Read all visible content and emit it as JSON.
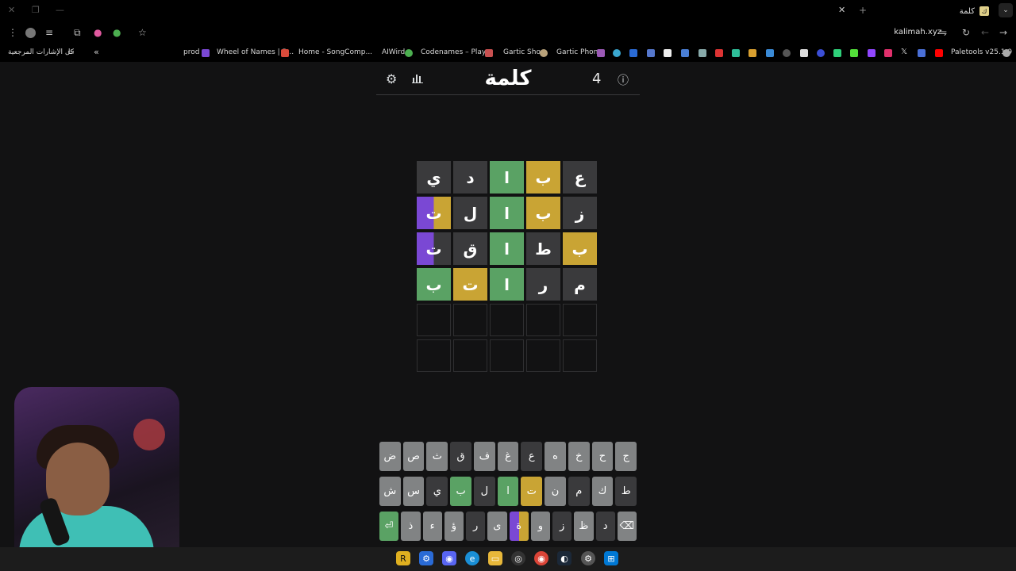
{
  "browser": {
    "tab_title": "كلمة",
    "tab_favicon": "ك",
    "url": "kalimah.xyz",
    "all_bookmarks": "كل الإشارات المرجعية",
    "bookmarks": [
      {
        "label": "prod"
      },
      {
        "label": "Wheel of Names | R..."
      },
      {
        "label": "Home - SongComp..."
      },
      {
        "label": "AIWird"
      },
      {
        "label": "Codenames – Play..."
      },
      {
        "label": "Gartic Show"
      },
      {
        "label": "Gartic Phone"
      },
      {
        "label": "Paletools v25.1.9"
      }
    ]
  },
  "game": {
    "title": "كلمة",
    "counter": "4",
    "board": [
      [
        {
          "l": "ي",
          "s": "d"
        },
        {
          "l": "د",
          "s": "d"
        },
        {
          "l": "ا",
          "s": "g"
        },
        {
          "l": "ب",
          "s": "y"
        },
        {
          "l": "ع",
          "s": "d"
        }
      ],
      [
        {
          "l": "ت",
          "s": "py"
        },
        {
          "l": "ل",
          "s": "d"
        },
        {
          "l": "ا",
          "s": "g"
        },
        {
          "l": "ب",
          "s": "y"
        },
        {
          "l": "ز",
          "s": "d"
        }
      ],
      [
        {
          "l": "ت",
          "s": "pd"
        },
        {
          "l": "ق",
          "s": "d"
        },
        {
          "l": "ا",
          "s": "g"
        },
        {
          "l": "ط",
          "s": "d"
        },
        {
          "l": "ب",
          "s": "y"
        }
      ],
      [
        {
          "l": "ب",
          "s": "g"
        },
        {
          "l": "ت",
          "s": "y"
        },
        {
          "l": "ا",
          "s": "g"
        },
        {
          "l": "ر",
          "s": "d"
        },
        {
          "l": "م",
          "s": "d"
        }
      ],
      [
        {
          "l": "",
          "s": "empty"
        },
        {
          "l": "",
          "s": "empty"
        },
        {
          "l": "",
          "s": "empty"
        },
        {
          "l": "",
          "s": "empty"
        },
        {
          "l": "",
          "s": "empty"
        }
      ],
      [
        {
          "l": "",
          "s": "empty"
        },
        {
          "l": "",
          "s": "empty"
        },
        {
          "l": "",
          "s": "empty"
        },
        {
          "l": "",
          "s": "empty"
        },
        {
          "l": "",
          "s": "empty"
        }
      ]
    ],
    "keyboard": [
      [
        {
          "k": "ض",
          "s": ""
        },
        {
          "k": "ص",
          "s": ""
        },
        {
          "k": "ث",
          "s": ""
        },
        {
          "k": "ق",
          "s": "kd"
        },
        {
          "k": "ف",
          "s": ""
        },
        {
          "k": "غ",
          "s": ""
        },
        {
          "k": "ع",
          "s": "kd"
        },
        {
          "k": "ه",
          "s": ""
        },
        {
          "k": "خ",
          "s": ""
        },
        {
          "k": "ح",
          "s": ""
        },
        {
          "k": "ج",
          "s": ""
        }
      ],
      [
        {
          "k": "ش",
          "s": ""
        },
        {
          "k": "س",
          "s": ""
        },
        {
          "k": "ي",
          "s": "kd"
        },
        {
          "k": "ب",
          "s": "kg"
        },
        {
          "k": "ل",
          "s": "kd"
        },
        {
          "k": "ا",
          "s": "kg"
        },
        {
          "k": "ت",
          "s": "ky"
        },
        {
          "k": "ن",
          "s": ""
        },
        {
          "k": "م",
          "s": "kd"
        },
        {
          "k": "ك",
          "s": ""
        },
        {
          "k": "ط",
          "s": "kd"
        }
      ],
      [
        {
          "k": "⏎",
          "s": "kg"
        },
        {
          "k": "ذ",
          "s": ""
        },
        {
          "k": "ء",
          "s": ""
        },
        {
          "k": "ؤ",
          "s": ""
        },
        {
          "k": "ر",
          "s": "kd"
        },
        {
          "k": "ى",
          "s": ""
        },
        {
          "k": "ة",
          "s": "kp"
        },
        {
          "k": "و",
          "s": ""
        },
        {
          "k": "ز",
          "s": "kd"
        },
        {
          "k": "ظ",
          "s": ""
        },
        {
          "k": "د",
          "s": "kd"
        },
        {
          "k": "⌫",
          "s": ""
        }
      ]
    ]
  }
}
